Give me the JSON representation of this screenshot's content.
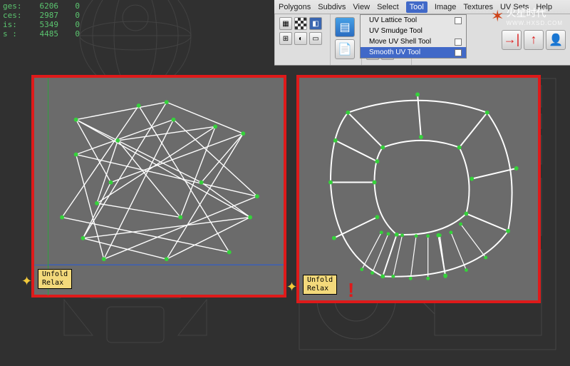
{
  "stats": {
    "rows": [
      {
        "label": "ges:",
        "a": "6206",
        "b": "0"
      },
      {
        "label": "ces:",
        "a": "2987",
        "b": "0"
      },
      {
        "label": "is:",
        "a": "5349",
        "b": "0"
      },
      {
        "label": "s :",
        "a": "4485",
        "b": "0"
      }
    ]
  },
  "menu": {
    "items": [
      "Polygons",
      "Subdivs",
      "View",
      "Select",
      "Tool",
      "Image",
      "Textures",
      "UV Sets",
      "Help"
    ],
    "highlighted": "Tool"
  },
  "submenu": {
    "items": [
      {
        "label": "UV Lattice Tool",
        "sel": false,
        "box": true
      },
      {
        "label": "UV Smudge Tool",
        "sel": false,
        "box": false
      },
      {
        "label": "Move UV Shell Tool",
        "sel": false,
        "box": true
      },
      {
        "label": "Smooth UV Tool",
        "sel": true,
        "box": true
      }
    ]
  },
  "toolbar": {
    "groups": {
      "g1": [
        "grid",
        "checker",
        "uv",
        "tile"
      ],
      "g2": [
        "page",
        "swap"
      ],
      "g3": [
        "flip-h",
        "flip-v",
        "rot-ccw",
        "rot-cw",
        "rot-l",
        "rot-r"
      ],
      "g4": [
        "arrow-right",
        "arrow-up",
        "user"
      ]
    }
  },
  "panel_left": {
    "labels": [
      "Unfold",
      "Relax"
    ]
  },
  "panel_right": {
    "labels": [
      "Unfold",
      "Relax"
    ],
    "mark": "!"
  },
  "logo": {
    "brand": "火星时代",
    "url": "WWW.HXSD.COM"
  }
}
